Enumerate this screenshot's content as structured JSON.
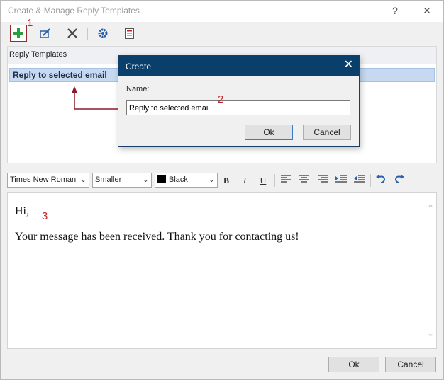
{
  "window": {
    "title": "Create & Manage Reply Templates",
    "help_label": "?",
    "close_label": "✕"
  },
  "markers": [
    "1",
    "2",
    "3"
  ],
  "templates": {
    "header": "Reply Templates",
    "items": [
      {
        "label": "Reply to selected email",
        "selected": true
      }
    ]
  },
  "dialog": {
    "title": "Create",
    "name_label": "Name:",
    "name_value": "Reply to selected email",
    "ok_label": "Ok",
    "cancel_label": "Cancel"
  },
  "formatting": {
    "font": "Times New Roman",
    "size": "Smaller",
    "color_name": "Black",
    "color": "#000000",
    "bold": "B",
    "italic": "I",
    "underline": "U"
  },
  "editor": {
    "line1": "Hi,",
    "line2": "Your message has been received. Thank you for contacting us!"
  },
  "footer": {
    "ok_label": "Ok",
    "cancel_label": "Cancel"
  },
  "colors": {
    "accent": "#0b3f6b",
    "selection": "#c6d9f1",
    "marker": "#c0272d"
  }
}
